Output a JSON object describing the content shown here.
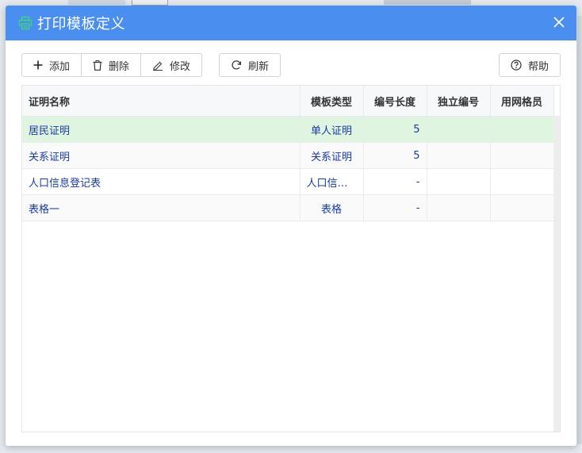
{
  "dialog": {
    "title": "打印模板定义",
    "icon": "printer-icon",
    "accent_color": "#4a8ef0"
  },
  "toolbar": {
    "add_label": "添加",
    "delete_label": "删除",
    "edit_label": "修改",
    "refresh_label": "刷新",
    "help_label": "帮助"
  },
  "table": {
    "columns": [
      "证明名称",
      "模板类型",
      "编号长度",
      "独立编号",
      "用网格员"
    ],
    "rows": [
      {
        "name": "居民证明",
        "type": "单人证明",
        "length": "5",
        "independent": "",
        "grid": "",
        "selected": true
      },
      {
        "name": "关系证明",
        "type": "关系证明",
        "length": "5",
        "independent": "",
        "grid": ""
      },
      {
        "name": "人口信息登记表",
        "type": "人口信息...",
        "length": "-",
        "independent": "",
        "grid": ""
      },
      {
        "name": "表格一",
        "type": "表格",
        "length": "-",
        "independent": "",
        "grid": ""
      }
    ],
    "selected_color": "#e0f5e0",
    "text_color": "#1a3aa0"
  }
}
